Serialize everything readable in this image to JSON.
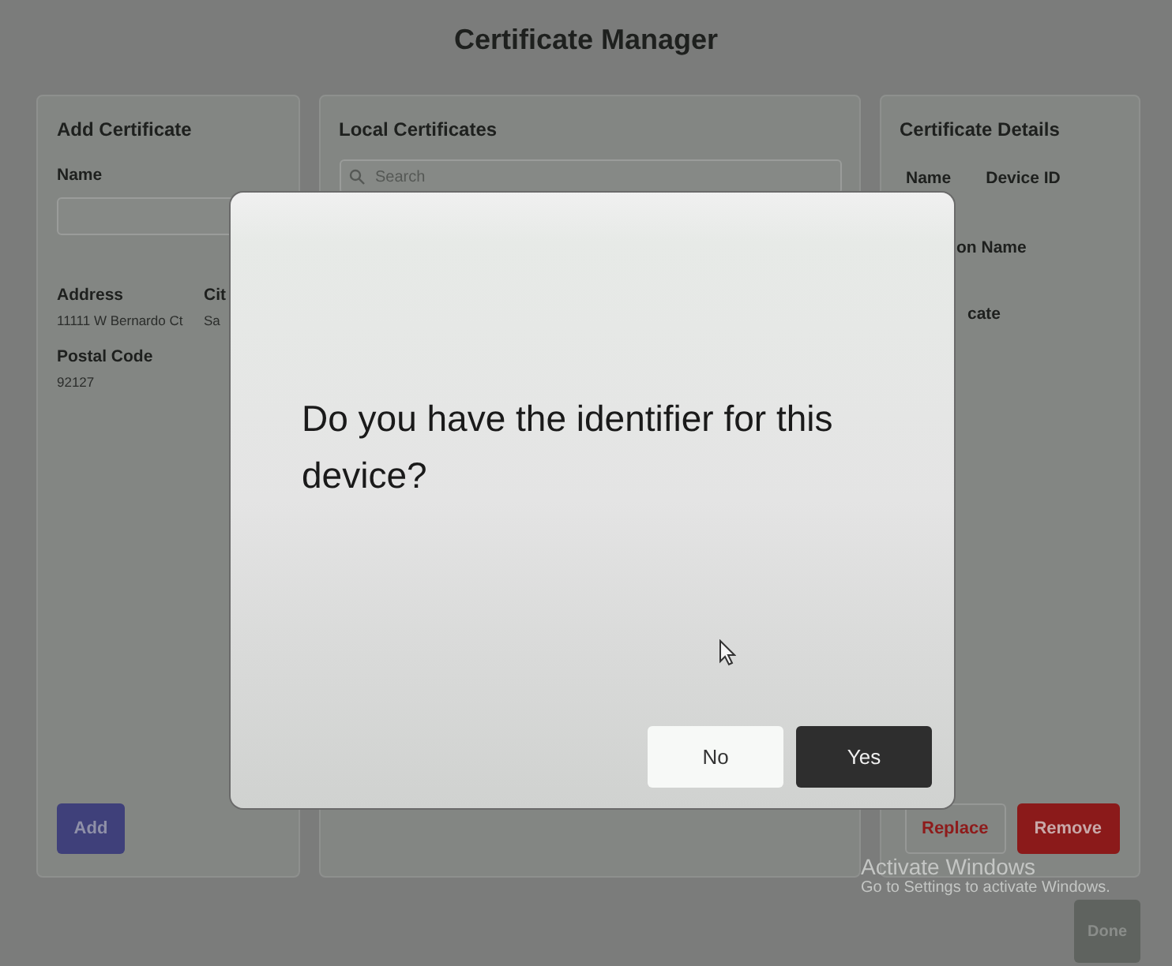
{
  "window": {
    "title": "Certificate Manager"
  },
  "add_certificate": {
    "title": "Add Certificate",
    "name_label": "Name",
    "fields": [
      {
        "label": "Address",
        "value": "11111 W Bernardo Ct"
      },
      {
        "label": "Cit",
        "value": "Sa"
      },
      {
        "label": "Postal Code",
        "value": "92127"
      }
    ],
    "add_button": "Add"
  },
  "local_certificates": {
    "title": "Local Certificates",
    "search": {
      "placeholder": "Search"
    }
  },
  "certificate_details": {
    "title": "Certificate Details",
    "labels": [
      "Name",
      "Device ID"
    ],
    "partial_labels": [
      "on Name",
      "cate"
    ],
    "buttons": [
      {
        "label": "Replace",
        "kind": "outline"
      },
      {
        "label": "Remove",
        "kind": "danger"
      }
    ]
  },
  "done_button": "Done",
  "dialog": {
    "message": "Do you have the identifier for this device?",
    "buttons": [
      {
        "label": "No",
        "kind": "secondary"
      },
      {
        "label": "Yes",
        "kind": "primary"
      }
    ]
  },
  "activation_notice": {
    "title": "Activate Windows",
    "subtitle": "Go to Settings to activate Windows."
  }
}
